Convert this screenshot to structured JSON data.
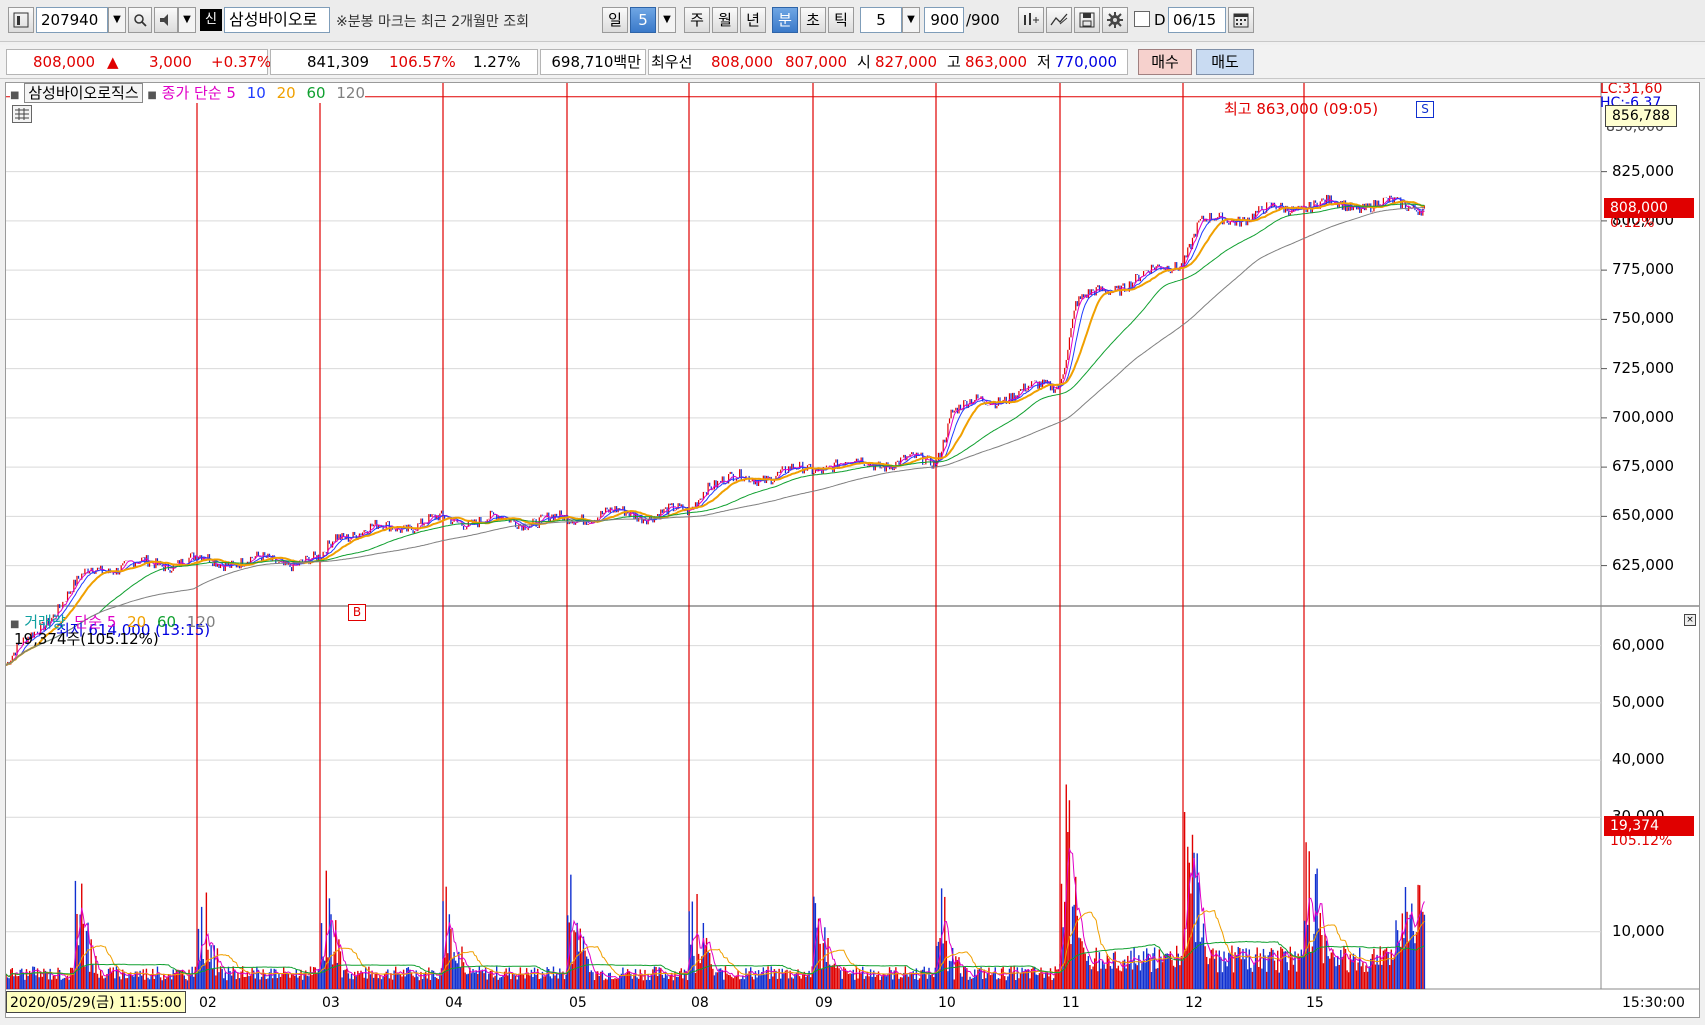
{
  "toolbar": {
    "code": "207940",
    "badge": "신",
    "name": "삼성바이오로",
    "note": "※분봉 마크는 최근 2개월만 조회",
    "period_buttons": [
      "일",
      "5",
      "주",
      "월",
      "년",
      "분",
      "초",
      "틱"
    ],
    "interval": "5",
    "count": "900",
    "count_total": "/900",
    "date_prefix": "D",
    "date": "06/15"
  },
  "quote": {
    "price": "808,000",
    "arrow": "▲",
    "change": "3,000",
    "change_pct": "+0.37%",
    "volume": "841,309",
    "vol_ratio": "106.57%",
    "turnover_pct": "1.27%",
    "amount": "698,710백만",
    "best_label": "최우선",
    "ask": "808,000",
    "bid": "807,000",
    "open_label": "시",
    "open": "827,000",
    "high_label": "고",
    "high": "863,000",
    "low_label": "저",
    "low": "770,000",
    "buy_label": "매수",
    "sell_label": "매도"
  },
  "price_panel": {
    "title": "삼성바이오로직스",
    "legend_type": "종가 단순",
    "ma": [
      "5",
      "10",
      "20",
      "60",
      "120"
    ],
    "high_marker": "최고 863,000 (09:05)",
    "low_marker": "최저 614,000 (13:15)",
    "buy_mark": "B",
    "sell_mark": "S",
    "lc": "LC:31,60",
    "hc": "HC:-6.37",
    "cursor_price": "856,788",
    "current_price": "808,000",
    "current_pct": "0.12%",
    "y_ticks": [
      "825,000",
      "800,000",
      "775,000",
      "750,000",
      "725,000",
      "700,000",
      "675,000",
      "650,000",
      "625,000"
    ],
    "top_tick": "850,000"
  },
  "volume_panel": {
    "title": "거래량",
    "legend_type": "단순",
    "ma": [
      "5",
      "20",
      "60",
      "120"
    ],
    "last": "19,374주(105.12%)",
    "y_ticks": [
      "60,000",
      "50,000",
      "40,000",
      "30,000",
      "10,000"
    ],
    "current": "19,374",
    "current_pct": "105.12%"
  },
  "x_axis": {
    "start": "2020/05/29(금) 11:55:00",
    "labels": [
      "02",
      "03",
      "04",
      "05",
      "08",
      "09",
      "10",
      "11",
      "12",
      "15"
    ],
    "end": "15:30:00"
  },
  "colors": {
    "ma5": "#e000c8",
    "ma10": "#1e3cff",
    "ma20": "#f0a000",
    "ma60": "#10a030",
    "ma120": "#808080",
    "up": "#e00000",
    "down": "#1030d0",
    "day_line": "#e00000"
  },
  "chart_data": {
    "type": "line",
    "x": [
      "05/29",
      "06/02",
      "06/03",
      "06/04",
      "06/05",
      "06/08",
      "06/09",
      "06/10",
      "06/11",
      "06/12",
      "06/15"
    ],
    "series": [
      {
        "name": "종가",
        "values": [
          614000,
          628000,
          627000,
          648000,
          648000,
          652000,
          674000,
          678000,
          718000,
          780000,
          808000
        ]
      }
    ],
    "ylabel": "",
    "ylim": [
      605000,
      870000
    ],
    "volume_ylim": [
      0,
      65000
    ]
  }
}
